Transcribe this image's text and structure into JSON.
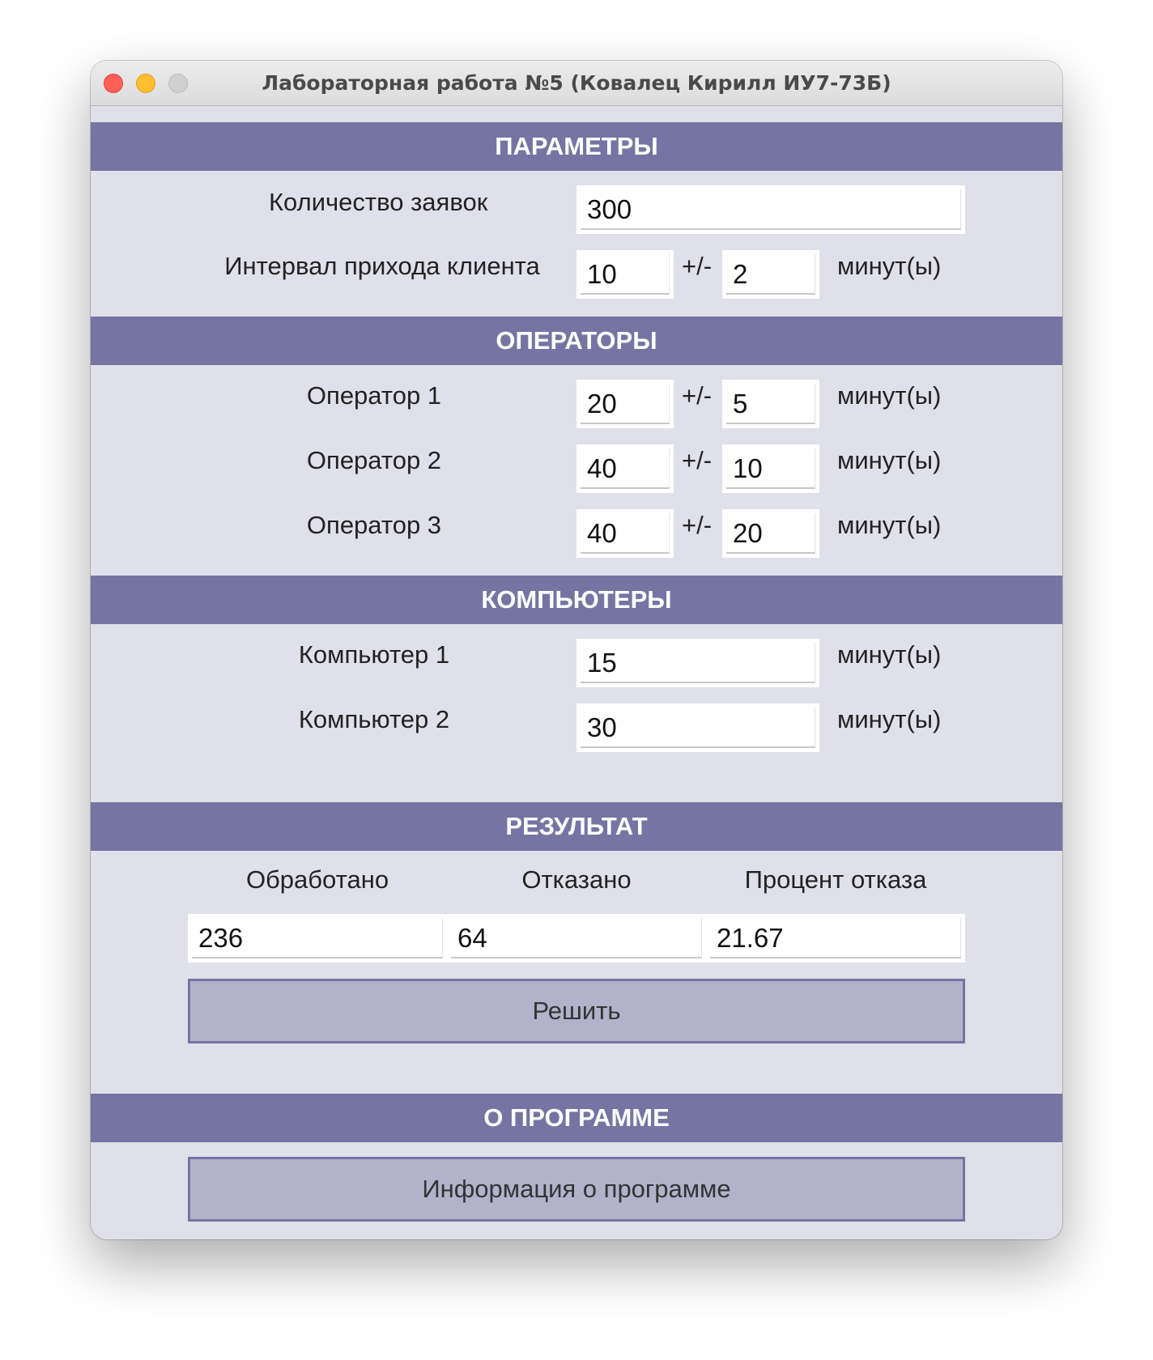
{
  "window": {
    "title": "Лабораторная работа №5 (Ковалец Кирилл ИУ7-73Б)"
  },
  "params": {
    "header": "ПАРАМЕТРЫ",
    "requests_label": "Количество заявок",
    "requests_value": "300",
    "interval_label": "Интервал прихода клиента",
    "interval_value": "10",
    "interval_delta": "2",
    "pm": "+/-",
    "unit": "минут(ы)"
  },
  "operators": {
    "header": "ОПЕРАТОРЫ",
    "items": [
      {
        "label": "Оператор 1",
        "value": "20",
        "delta": "5"
      },
      {
        "label": "Оператор 2",
        "value": "40",
        "delta": "10"
      },
      {
        "label": "Оператор 3",
        "value": "40",
        "delta": "20"
      }
    ]
  },
  "computers": {
    "header": "КОМПЬЮТЕРЫ",
    "items": [
      {
        "label": "Компьютер 1",
        "value": "15"
      },
      {
        "label": "Компьютер 2",
        "value": "30"
      }
    ]
  },
  "result": {
    "header": "РЕЗУЛЬТАТ",
    "processed_label": "Обработано",
    "rejected_label": "Отказано",
    "percent_label": "Процент отказа",
    "processed_value": "236",
    "rejected_value": "64",
    "percent_value": "21.67",
    "solve_button": "Решить"
  },
  "about": {
    "header": "О ПРОГРАММЕ",
    "info_button": "Информация о программе"
  }
}
